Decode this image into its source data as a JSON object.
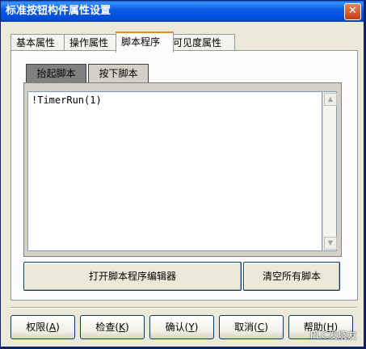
{
  "window": {
    "title": "标准按钮构件属性设置",
    "close_glyph": "✕"
  },
  "tabs": [
    {
      "label": "基本属性"
    },
    {
      "label": "操作属性"
    },
    {
      "label": "脚本程序"
    },
    {
      "label": "可见度属性"
    }
  ],
  "inner_tabs": [
    {
      "label": "抬起脚本"
    },
    {
      "label": "按下脚本"
    }
  ],
  "editor": {
    "content": "!TimerRun(1)"
  },
  "actions": {
    "open_editor": "打开脚本程序编辑器",
    "clear_all": "清空所有脚本"
  },
  "footer": {
    "buttons": [
      {
        "label": "权限(",
        "key": "A",
        "end": ")"
      },
      {
        "label": "检查(",
        "key": "K",
        "end": ")"
      },
      {
        "label": "确认(",
        "key": "Y",
        "end": ")"
      },
      {
        "label": "取消(",
        "key": "C",
        "end": ")"
      },
      {
        "label": "帮助(",
        "key": "H",
        "end": ")"
      }
    ]
  },
  "watermark": "PLC发烧友",
  "icons": {
    "scroll_up": "scroll-up-arrow-icon",
    "scroll_down": "scroll-down-arrow-icon"
  }
}
